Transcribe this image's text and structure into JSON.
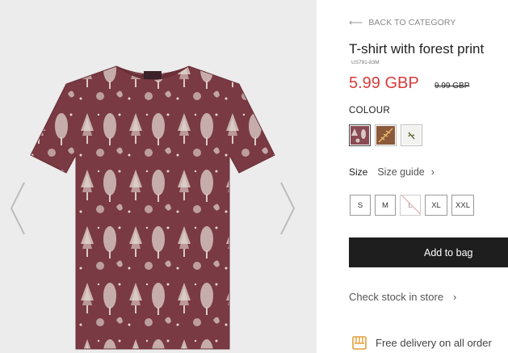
{
  "gallery": {
    "prev_icon": "chevron-left-icon",
    "next_icon": "chevron-right-icon"
  },
  "product": {
    "back_label": "BACK TO CATEGORY",
    "title": "T-shirt with forest print",
    "sku": "US791-83M",
    "price": "5.99 GBP",
    "old_price": "9.99 GBP",
    "colour_label": "COLOUR",
    "swatches": [
      {
        "name": "burgundy-forest",
        "color": "#8a4a52"
      },
      {
        "name": "brown-leaf",
        "color": "#8a5a3a"
      },
      {
        "name": "white-sprig",
        "color": "#f2f2ee"
      }
    ],
    "size_label": "Size",
    "size_guide_label": "Size guide",
    "sizes": [
      "S",
      "M",
      "L",
      "XL",
      "XXL"
    ],
    "unavailable_size": "L",
    "add_to_bag_label": "Add to bag",
    "check_stock_label": "Check stock in store",
    "delivery_label": "Free delivery on all order"
  },
  "colors": {
    "price_red": "#d73c3c",
    "button_dark": "#1e1e1e",
    "shirt_main": "#7a3a43",
    "print_light": "#d9c9c6"
  }
}
